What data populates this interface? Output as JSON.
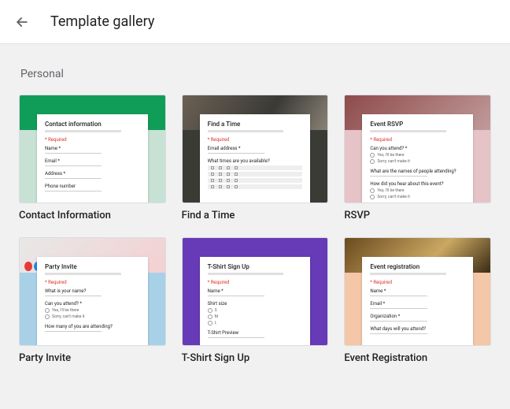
{
  "header": {
    "title": "Template gallery"
  },
  "section": {
    "label": "Personal"
  },
  "templates": [
    {
      "label": "Contact Information",
      "formTitle": "Contact information",
      "bgClass": "bg-green",
      "fields": [
        "Name *",
        "Email *",
        "Address *",
        "Phone number"
      ]
    },
    {
      "label": "Find a Time",
      "formTitle": "Find a Time",
      "bgClass": "bg-photo1",
      "fields": [
        "Email address *",
        "What times are you available?"
      ]
    },
    {
      "label": "RSVP",
      "formTitle": "Event RSVP",
      "bgClass": "bg-pink",
      "fields": [
        "Can you attend? *",
        "What are the names of people attending?",
        "How did you hear about this event?"
      ]
    },
    {
      "label": "Party Invite",
      "formTitle": "Party Invite",
      "bgClass": "bg-blue",
      "fields": [
        "What is your name?",
        "Can you attend? *",
        "How many of you are attending?"
      ]
    },
    {
      "label": "T-Shirt Sign Up",
      "formTitle": "T-Shirt Sign Up",
      "bgClass": "bg-purple",
      "fields": [
        "Name *",
        "Shirt size",
        "T-Shirt Preview"
      ]
    },
    {
      "label": "Event Registration",
      "formTitle": "Event registration",
      "bgClass": "bg-orange",
      "fields": [
        "Name *",
        "Email *",
        "Organization *",
        "What days will you attend?"
      ]
    }
  ],
  "required_label": "* Required"
}
